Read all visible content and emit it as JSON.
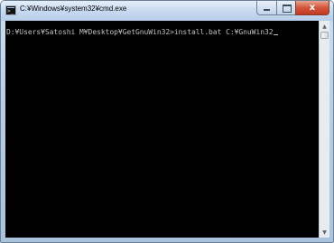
{
  "window": {
    "title": "C:¥Windows¥system32¥cmd.exe",
    "icon": "console-icon",
    "close_label": "x"
  },
  "console": {
    "lines": [
      "D:¥Users¥Satoshi M¥Desktop¥GetGnuWin32>install.bat C:¥GnuWin32"
    ]
  },
  "scrollbar": {
    "up_glyph": "▲",
    "down_glyph": "▼"
  }
}
